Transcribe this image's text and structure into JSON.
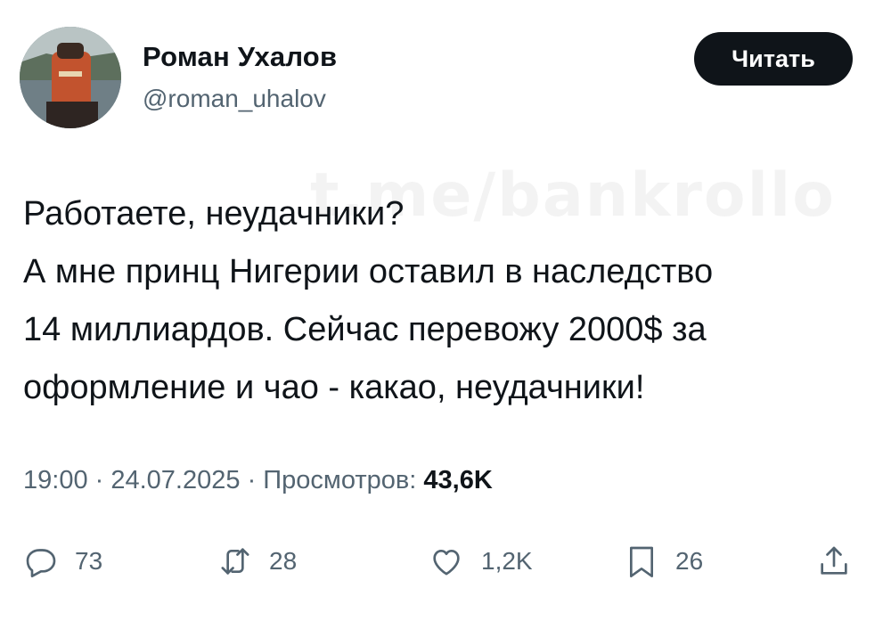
{
  "author": {
    "display_name": "Роман Ухалов",
    "handle": "@roman_uhalov"
  },
  "follow_button": {
    "label": "Читать"
  },
  "tweet": {
    "lines": [
      "Работаете, неудачники?",
      "А мне принц Нигерии оставил в наследство",
      "14 миллиардов. Сейчас перевожу 2000$ за",
      "оформление и чао - какао, неудачники!"
    ]
  },
  "watermark": "t.me/bankrollo",
  "meta": {
    "time": "19:00",
    "separator": " · ",
    "date": "24.07.2025",
    "views_label": "Просмотров:",
    "views_count": "43,6K"
  },
  "actions": {
    "reply_count": "73",
    "repost_count": "28",
    "like_count": "1,2K",
    "bookmark_count": "26"
  },
  "colors": {
    "text_primary": "#0f1419",
    "text_secondary": "#536471",
    "button_bg": "#0f1419"
  },
  "icons": [
    "reply-icon",
    "repost-icon",
    "like-icon",
    "bookmark-icon",
    "share-icon"
  ]
}
